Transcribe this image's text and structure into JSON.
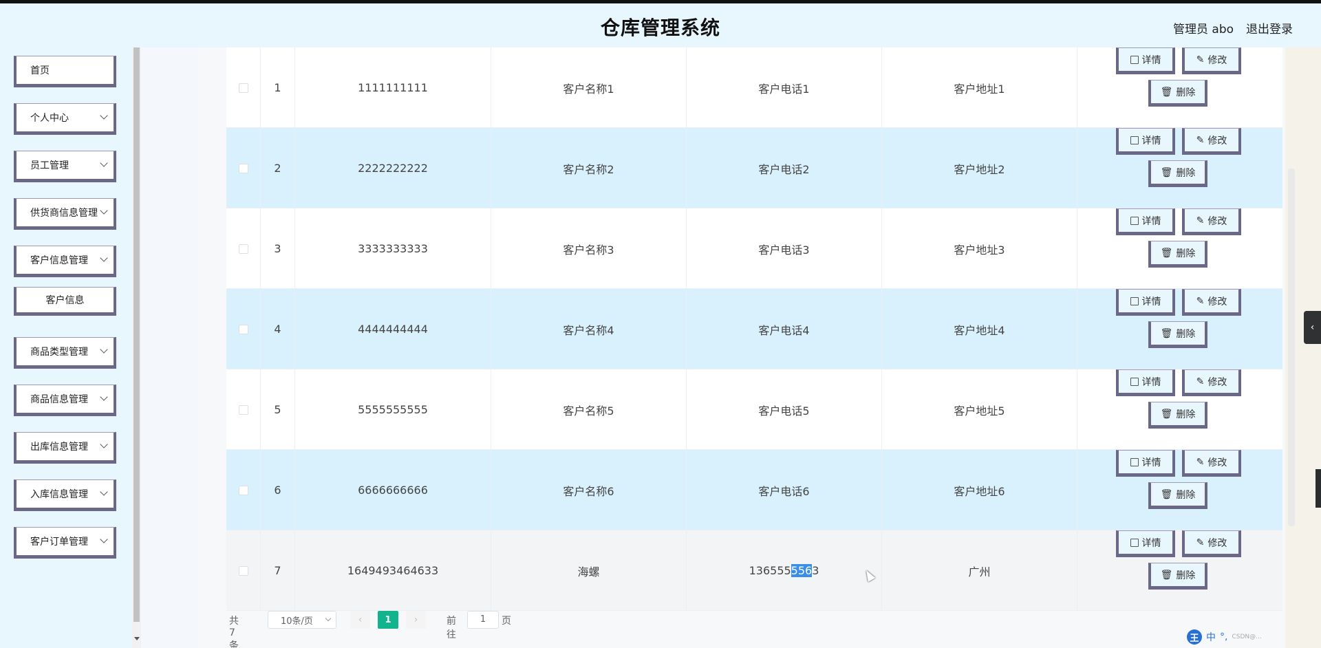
{
  "header": {
    "title": "仓库管理系统",
    "user": "管理员 abo",
    "logout": "退出登录"
  },
  "sidebar": {
    "items": [
      {
        "label": "首页",
        "expandable": false
      },
      {
        "label": "个人中心",
        "expandable": true
      },
      {
        "label": "员工管理",
        "expandable": true
      },
      {
        "label": "供货商信息管理",
        "expandable": true
      },
      {
        "label": "客户信息管理",
        "expandable": true
      },
      {
        "label": "客户信息",
        "expandable": false,
        "submenu": true
      },
      {
        "label": "商品类型管理",
        "expandable": true
      },
      {
        "label": "商品信息管理",
        "expandable": true
      },
      {
        "label": "出库信息管理",
        "expandable": true
      },
      {
        "label": "入库信息管理",
        "expandable": true
      },
      {
        "label": "客户订单管理",
        "expandable": true
      }
    ]
  },
  "table": {
    "rows": [
      {
        "index": "1",
        "account": "1111111111",
        "name": "客户名称1",
        "phone": "客户电话1",
        "address": "客户地址1"
      },
      {
        "index": "2",
        "account": "2222222222",
        "name": "客户名称2",
        "phone": "客户电话2",
        "address": "客户地址2"
      },
      {
        "index": "3",
        "account": "3333333333",
        "name": "客户名称3",
        "phone": "客户电话3",
        "address": "客户地址3"
      },
      {
        "index": "4",
        "account": "4444444444",
        "name": "客户名称4",
        "phone": "客户电话4",
        "address": "客户地址4"
      },
      {
        "index": "5",
        "account": "5555555555",
        "name": "客户名称5",
        "phone": "客户电话5",
        "address": "客户地址5"
      },
      {
        "index": "6",
        "account": "6666666666",
        "name": "客户名称6",
        "phone": "客户电话6",
        "address": "客户地址6"
      },
      {
        "index": "7",
        "account": "1649493464633",
        "name": "海螺",
        "phone_prefix": "136555",
        "phone_selected": "556",
        "phone_suffix": "3",
        "address": "广州"
      }
    ],
    "actions": {
      "detail": "详情",
      "edit": "修改",
      "delete": "删除"
    }
  },
  "pagination": {
    "total": "共 7 条",
    "page_size": "10条/页",
    "prev": "‹",
    "next": "›",
    "current_page": "1",
    "goto_label": "前往",
    "goto_value": "1",
    "page_suffix": "页"
  },
  "ime": {
    "logo": "王",
    "mode": "中",
    "punct": "°,",
    "watermark": "CSDN@..."
  },
  "colors": {
    "accent": "#11b48c",
    "alt_row": "#d9f1fd",
    "button_border": "#6b6787",
    "background": "#e8f6fe"
  }
}
